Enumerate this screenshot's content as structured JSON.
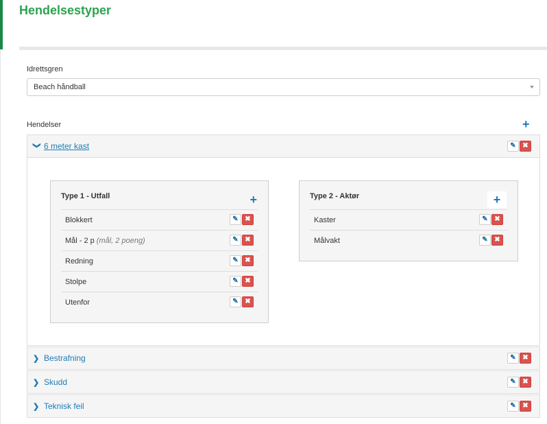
{
  "page": {
    "title": "Hendelsestyper"
  },
  "sport": {
    "label": "Idrettsgren",
    "value": "Beach håndball"
  },
  "events": {
    "label": "Hendelser",
    "add_symbol": "+",
    "edit_symbol": "✎",
    "delete_symbol": "✖",
    "panels": [
      {
        "label": "6 meter kast",
        "expanded": true,
        "chevron": "❯"
      },
      {
        "label": "Bestrafning",
        "expanded": false,
        "chevron": "❯"
      },
      {
        "label": "Skudd",
        "expanded": false,
        "chevron": "❯"
      },
      {
        "label": "Teknisk feil",
        "expanded": false,
        "chevron": "❯"
      }
    ]
  },
  "types": [
    {
      "title": "Type 1 - Utfall",
      "items": [
        {
          "label": "Blokkert",
          "note": ""
        },
        {
          "label": "Mål - 2 p",
          "note": "(mål, 2 poeng)"
        },
        {
          "label": "Redning",
          "note": ""
        },
        {
          "label": "Stolpe",
          "note": ""
        },
        {
          "label": "Utenfor",
          "note": ""
        }
      ]
    },
    {
      "title": "Type 2 - Aktør",
      "items": [
        {
          "label": "Kaster",
          "note": ""
        },
        {
          "label": "Målvakt",
          "note": ""
        }
      ]
    }
  ],
  "colors": {
    "accent_green": "#2ba34f",
    "link_blue": "#1f7bb6",
    "delete_red": "#d9534f"
  }
}
